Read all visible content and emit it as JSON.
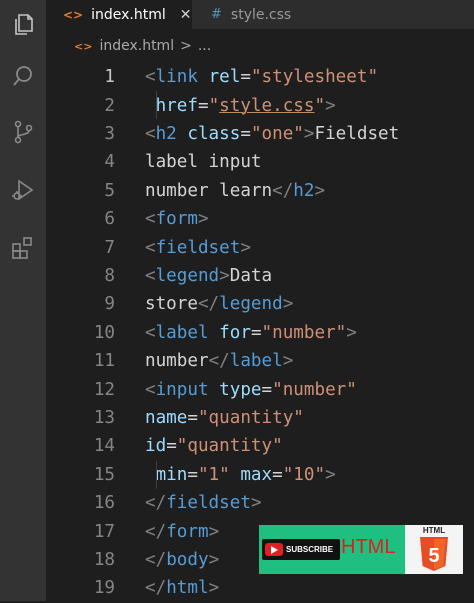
{
  "tabs": [
    {
      "label": "index.html",
      "icon": "html-file-icon",
      "active": true
    },
    {
      "label": "style.css",
      "icon": "css-file-icon",
      "active": false
    }
  ],
  "tab_glyphs": {
    "html": "<>",
    "css": "#",
    "close": "✕"
  },
  "breadcrumb": {
    "file": "index.html",
    "separator": ">",
    "more": "..."
  },
  "activity_icons": [
    "explorer-icon",
    "search-icon",
    "source-control-icon",
    "run-debug-icon",
    "extensions-icon"
  ],
  "editor": {
    "current_line": 1,
    "lines": [
      {
        "n": "1",
        "tokens": [
          {
            "c": "tag",
            "t": "<"
          },
          {
            "c": "tn",
            "t": "link"
          },
          {
            "c": "tx",
            "t": " "
          },
          {
            "c": "at",
            "t": "rel"
          },
          {
            "c": "tx",
            "t": "="
          },
          {
            "c": "st",
            "t": "\"stylesheet\""
          }
        ]
      },
      {
        "n": "2",
        "tokens": [
          {
            "c": "tx",
            "t": " "
          },
          {
            "c": "at",
            "t": "href"
          },
          {
            "c": "tx",
            "t": "="
          },
          {
            "c": "st",
            "t": "\""
          },
          {
            "c": "st ul",
            "t": "style.css"
          },
          {
            "c": "st",
            "t": "\""
          },
          {
            "c": "tag",
            "t": ">"
          }
        ]
      },
      {
        "n": "3",
        "tokens": [
          {
            "c": "tag",
            "t": "<"
          },
          {
            "c": "tn",
            "t": "h2"
          },
          {
            "c": "tx",
            "t": " "
          },
          {
            "c": "at",
            "t": "class"
          },
          {
            "c": "tx",
            "t": "="
          },
          {
            "c": "st",
            "t": "\"one\""
          },
          {
            "c": "tag",
            "t": ">"
          },
          {
            "c": "tx",
            "t": "Fieldset"
          }
        ]
      },
      {
        "n": "4",
        "tokens": [
          {
            "c": "tx",
            "t": "label input"
          }
        ]
      },
      {
        "n": "5",
        "tokens": [
          {
            "c": "tx",
            "t": "number learn"
          },
          {
            "c": "tag",
            "t": "</"
          },
          {
            "c": "tn",
            "t": "h2"
          },
          {
            "c": "tag",
            "t": ">"
          }
        ]
      },
      {
        "n": "6",
        "tokens": [
          {
            "c": "tag",
            "t": "<"
          },
          {
            "c": "tn",
            "t": "form"
          },
          {
            "c": "tag",
            "t": ">"
          }
        ]
      },
      {
        "n": "7",
        "tokens": [
          {
            "c": "tag",
            "t": "<"
          },
          {
            "c": "tn",
            "t": "fieldset"
          },
          {
            "c": "tag",
            "t": ">"
          }
        ]
      },
      {
        "n": "8",
        "tokens": [
          {
            "c": "tag",
            "t": "<"
          },
          {
            "c": "tn",
            "t": "legend"
          },
          {
            "c": "tag",
            "t": ">"
          },
          {
            "c": "tx",
            "t": "Data"
          }
        ]
      },
      {
        "n": "9",
        "tokens": [
          {
            "c": "tx",
            "t": "store"
          },
          {
            "c": "tag",
            "t": "</"
          },
          {
            "c": "tn",
            "t": "legend"
          },
          {
            "c": "tag",
            "t": ">"
          }
        ]
      },
      {
        "n": "10",
        "tokens": [
          {
            "c": "tag",
            "t": "<"
          },
          {
            "c": "tn",
            "t": "label"
          },
          {
            "c": "tx",
            "t": " "
          },
          {
            "c": "at",
            "t": "for"
          },
          {
            "c": "tx",
            "t": "="
          },
          {
            "c": "st",
            "t": "\"number\""
          },
          {
            "c": "tag",
            "t": ">"
          }
        ]
      },
      {
        "n": "11",
        "tokens": [
          {
            "c": "tx",
            "t": "number"
          },
          {
            "c": "tag",
            "t": "</"
          },
          {
            "c": "tn",
            "t": "label"
          },
          {
            "c": "tag",
            "t": ">"
          }
        ]
      },
      {
        "n": "12",
        "tokens": [
          {
            "c": "tag",
            "t": "<"
          },
          {
            "c": "tn",
            "t": "input"
          },
          {
            "c": "tx",
            "t": " "
          },
          {
            "c": "at",
            "t": "type"
          },
          {
            "c": "tx",
            "t": "="
          },
          {
            "c": "st",
            "t": "\"number\""
          }
        ]
      },
      {
        "n": "13",
        "tokens": [
          {
            "c": "at",
            "t": "name"
          },
          {
            "c": "tx",
            "t": "="
          },
          {
            "c": "st",
            "t": "\"quantity\""
          }
        ]
      },
      {
        "n": "14",
        "tokens": [
          {
            "c": "at",
            "t": "id"
          },
          {
            "c": "tx",
            "t": "="
          },
          {
            "c": "st",
            "t": "\"quantity\""
          }
        ]
      },
      {
        "n": "15",
        "tokens": [
          {
            "c": "tx",
            "t": " "
          },
          {
            "c": "at",
            "t": "min"
          },
          {
            "c": "tx",
            "t": "="
          },
          {
            "c": "st",
            "t": "\"1\""
          },
          {
            "c": "tx",
            "t": " "
          },
          {
            "c": "at",
            "t": "max"
          },
          {
            "c": "tx",
            "t": "="
          },
          {
            "c": "st",
            "t": "\"10\""
          },
          {
            "c": "tag",
            "t": ">"
          }
        ]
      },
      {
        "n": "16",
        "tokens": [
          {
            "c": "tag",
            "t": "</"
          },
          {
            "c": "tn",
            "t": "fieldset"
          },
          {
            "c": "tag",
            "t": ">"
          }
        ]
      },
      {
        "n": "17",
        "tokens": [
          {
            "c": "tag",
            "t": "</"
          },
          {
            "c": "tn",
            "t": "form"
          },
          {
            "c": "tag",
            "t": ">"
          }
        ]
      },
      {
        "n": "18",
        "tokens": [
          {
            "c": "tag",
            "t": "</"
          },
          {
            "c": "tn",
            "t": "body"
          },
          {
            "c": "tag",
            "t": ">"
          }
        ]
      },
      {
        "n": "19",
        "tokens": [
          {
            "c": "tag",
            "t": "</"
          },
          {
            "c": "tn",
            "t": "html"
          },
          {
            "c": "tag",
            "t": ">"
          }
        ]
      }
    ]
  },
  "banner": {
    "subscribe_label": "SUBSCRIBE",
    "html_label": "HTML",
    "badge_label": "HTML",
    "badge_number": "5",
    "accent_color": "#1fbf7f",
    "logo_color": "#e44d26"
  }
}
